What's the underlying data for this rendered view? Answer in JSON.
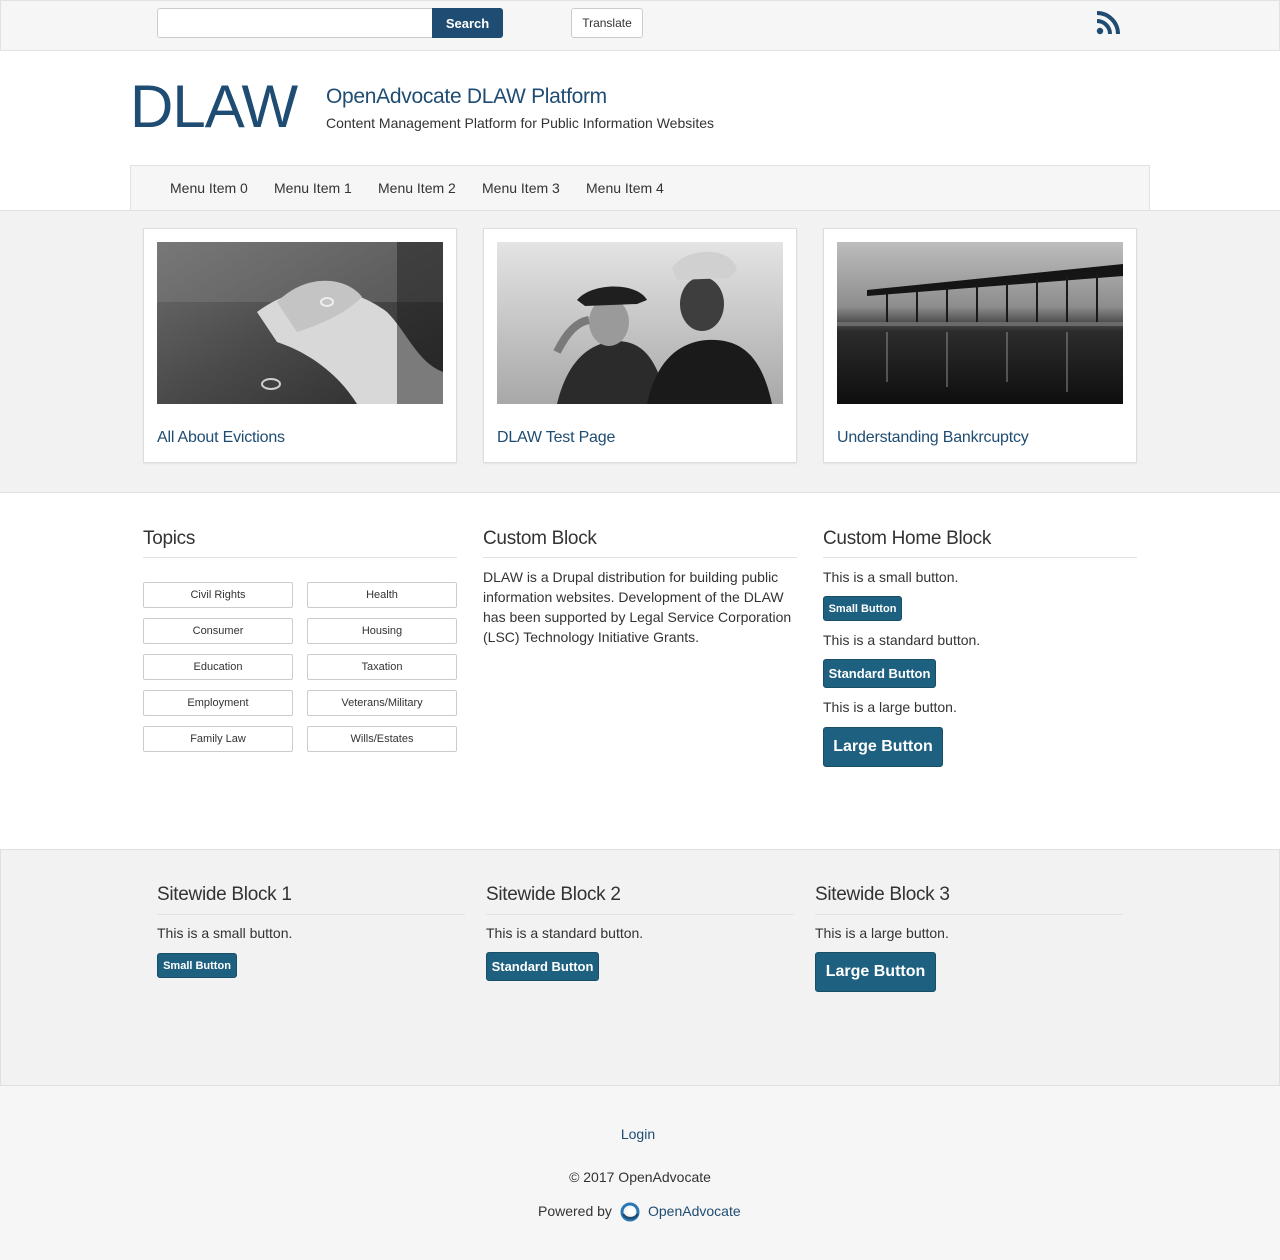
{
  "topbar": {
    "search_placeholder": "",
    "search_label": "Search",
    "translate_label": "Translate",
    "rss_icon": "rss-icon"
  },
  "header": {
    "logo": "DLAW",
    "site_name": "OpenAdvocate DLAW Platform",
    "slogan": "Content Management Platform for Public Information Websites"
  },
  "nav": {
    "items": [
      "Menu Item 0",
      "Menu Item 1",
      "Menu Item 2",
      "Menu Item 3",
      "Menu Item 4"
    ]
  },
  "featured": {
    "cards": [
      {
        "title": "All About Evictions",
        "image": "hands-ring-photo"
      },
      {
        "title": "DLAW Test Page",
        "image": "veterans-salute-photo"
      },
      {
        "title": "Understanding Bankrcuptcy",
        "image": "pier-sunset-photo"
      }
    ]
  },
  "topics": {
    "title": "Topics",
    "left": [
      "Civil Rights",
      "Consumer",
      "Education",
      "Employment",
      "Family Law"
    ],
    "right": [
      "Health",
      "Housing",
      "Taxation",
      "Veterans/Military",
      "Wills/Estates"
    ]
  },
  "custom_block": {
    "title": "Custom Block",
    "lines": [
      "DLAW is a Drupal distribution for building public",
      "information websites. Development of the DLAW",
      "has been supported by Legal Service Corporation",
      "(LSC) Technology Initiative Grants."
    ]
  },
  "custom_home_block": {
    "title": "Custom Home Block",
    "small_text": "This is a small button.",
    "small_label": "Small Button",
    "standard_text": "This is a  standard button.",
    "standard_label": "Standard Button",
    "large_text": "This is a  large  button.",
    "large_label": "Large Button"
  },
  "sitewide": {
    "block1": {
      "title": "Sitewide Block 1",
      "text": "This is a small button.",
      "button": "Small Button"
    },
    "block2": {
      "title": "Sitewide Block 2",
      "text": "This is a  standard button.",
      "button": "Standard Button"
    },
    "block3": {
      "title": "Sitewide Block 3",
      "text": "This is a  large  button.",
      "button": "Large Button"
    }
  },
  "footer": {
    "login": "Login",
    "copyright": "© 2017 OpenAdvocate",
    "powered_by": "Powered by",
    "powered_name": "OpenAdvocate",
    "powered_icon": "openadvocate-logo-icon"
  },
  "colors": {
    "brand": "#1f4c72",
    "button": "#1e6080",
    "panel": "#f2f2f2"
  }
}
